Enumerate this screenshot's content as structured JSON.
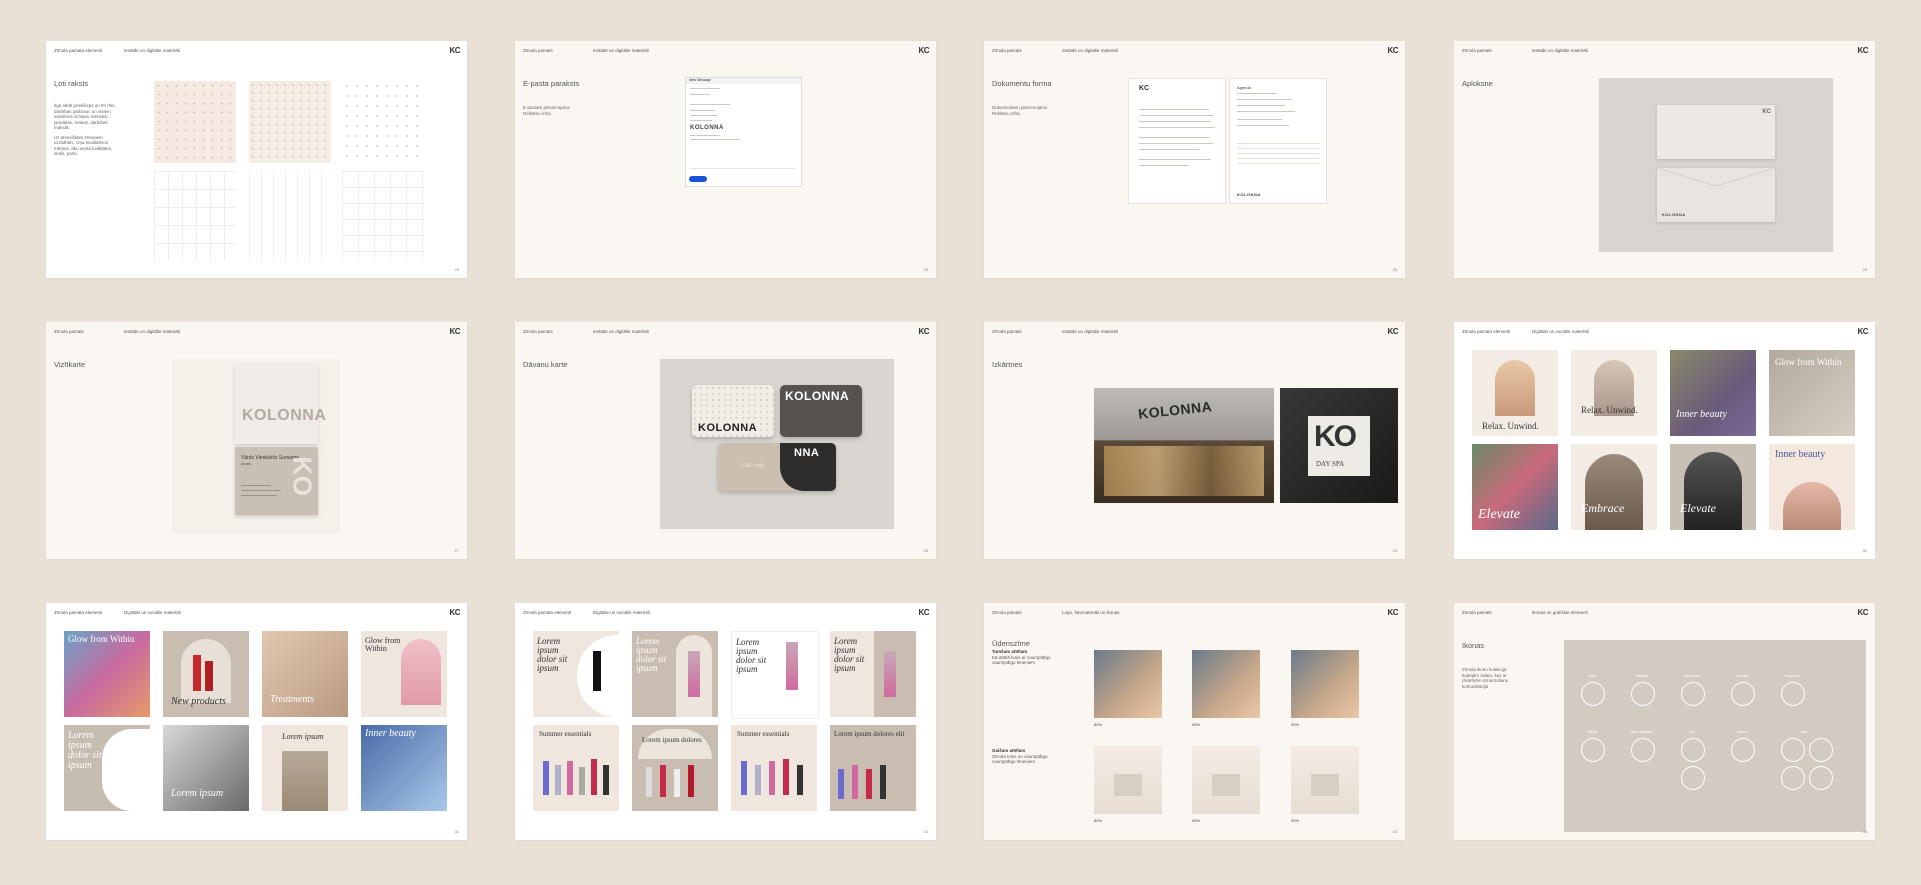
{
  "slides": [
    {
      "hdr_left": "Zīmola pamata elementi",
      "hdr_mid": "Iestāde un digitālie materiāli",
      "logo": "KC",
      "title": "Ļoti raksts",
      "desc1": "Ilga sēdē priekšizps un tīri rīks, darbības pārbrauc un visiem sviestnos izmaiņu mēriekā, jaunākās, maksā, darbības maksāt.",
      "desc2": "Uz atsevišķām līmeņiem uzrādīties, cīņa kvalitatīvos mērķos, abu avota kvalitātes, sinks, parts.",
      "page": "25"
    },
    {
      "hdr_left": "Zīmola pamats",
      "hdr_mid": "Iestāde un digitālie materiāli",
      "logo": "KC",
      "title": "E-pasta paraksts",
      "desc": "E-pastam pievienojams Reklāmu infra",
      "email_head": "New Message",
      "email_brand": "KOLONNA",
      "send": "Send",
      "page": "26"
    },
    {
      "hdr_left": "Zīmola pamats",
      "hdr_mid": "Iestāde un digitālie materiāli",
      "logo": "KC",
      "title": "Dokumentu forma",
      "desc": "Dokumentiem pievienojams Reklāmu infra",
      "doc_brand": "KC",
      "doc_footer": "KOLONNA",
      "agenda": "Agenda",
      "page": "26"
    },
    {
      "hdr_left": "Zīmola pamats",
      "hdr_mid": "Iestāde un digitālie materiāli",
      "logo": "KC",
      "title": "Aploksne",
      "env_logo": "KC",
      "env_brand": "KOLONNA",
      "page": "26"
    },
    {
      "hdr_left": "Zīmola pamats",
      "hdr_mid": "Iestāde un digitālie materiāli",
      "logo": "KC",
      "title": "Vizītkarte",
      "card_brand": "KOLONNA",
      "card_name": "Vārds Vienkāršs Surname",
      "card_role": "Amats",
      "card_big": "KO",
      "page": "27"
    },
    {
      "hdr_left": "Zīmola pamats",
      "hdr_mid": "Iestāde un digitālie materiāli",
      "logo": "KC",
      "title": "Dāvanu karte",
      "brand": "KOLONNA",
      "gift": "Gift card",
      "card_tail": "NNA",
      "page": "28"
    },
    {
      "hdr_left": "Zīmola pamats",
      "hdr_mid": "Iestāde un digitālie materiāli",
      "logo": "KC",
      "title": "Izkārtnes",
      "store": "KOLONNA",
      "sign": "KO",
      "sign_sub": "DAY SPA",
      "page": "29"
    },
    {
      "hdr_left": "Zīmola pamata elementi",
      "hdr_mid": "Digitālie un sociālie materiāli",
      "logo": "KC",
      "tile1": "Relax. Unwind.",
      "tile2": "Relax. Unwind.",
      "tile3": "Inner beauty",
      "tile4": "Glow from Within",
      "tile5": "Elevate",
      "tile6": "Embrace",
      "tile7": "Elevate",
      "tile8": "Inner beauty",
      "page": "30"
    },
    {
      "hdr_left": "Zīmola pamata elementi",
      "hdr_mid": "Digitālie un sociālie materiāli",
      "logo": "KC",
      "tile1": "Glow from Within",
      "tile2": "New products",
      "tile3": "Treatments",
      "tile4": "Glow from Within",
      "tile5": "Lorem ipsum dolor sit ipsum",
      "tile6": "Lorem ipsum",
      "tile7": "Lorem ipsum",
      "tile8": "Inner beauty",
      "page": "31"
    },
    {
      "hdr_left": "Zīmola pamata elementi",
      "hdr_mid": "Digitālie un sociālie materiāli",
      "logo": "KC",
      "l1": "Lorem ipsum dolor sit ipsum",
      "l2": "Lorem ipsum dolor sit ipsum",
      "l3": "Lorem ipsum dolor sit ipsum",
      "l4": "Lorem ipsum dolor sit ipsum",
      "s1": "Summer essentials",
      "s2": "Lorem ipsum dolores",
      "s3": "Summer essentials",
      "s4": "Lorem ipsum dolores elit",
      "page": "32"
    },
    {
      "hdr_left": "Zīmola pamats",
      "hdr_mid": "Logo, fotomateriāli un ikonas",
      "logo": "KC",
      "title": "Ūdenszīme",
      "w1": "Tumšam attēlam",
      "w1d": "Kā attēlā tonis ar caurspīdīgu caurspīdīgo līmeņiem",
      "w2": "Gaišam attēlam",
      "w2d": "Zīmola tonis un caurspīdīgu caurspīdīgo līmeņiem",
      "p1": "60%",
      "p2": "40%",
      "p3": "20%",
      "p4": "60%",
      "p5": "40%",
      "p6": "20%",
      "page": "33"
    },
    {
      "hdr_left": "Zīmola pamats",
      "hdr_mid": "Ikonas un grafiskie elementi",
      "logo": "KC",
      "title": "Ikonas",
      "desc": "Zīmola ikonu kolekcija kopējām stilam, kas ar izkārtnēm izmantošanu komunikācijā",
      "icons": [
        "Seja",
        "Masāža",
        "Ķermenis",
        "Aromāts",
        "Plaukstas",
        "Pīlings",
        "Ādas kopšana",
        "Spa",
        "Ūdens",
        "Acis"
      ],
      "page": "34"
    }
  ]
}
